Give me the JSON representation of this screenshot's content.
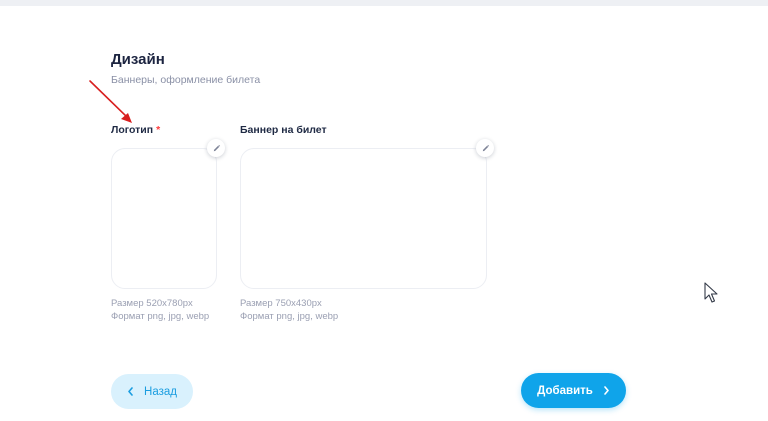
{
  "section": {
    "title": "Дизайн",
    "subtitle": "Баннеры, оформление билета"
  },
  "logo": {
    "label": "Логотип",
    "required_mark": "*",
    "size_hint": "Размер 520х780px",
    "format_hint": "Формат png, jpg, webp"
  },
  "banner": {
    "label": "Баннер на билет",
    "size_hint": "Размер 750х430px",
    "format_hint": "Формат png, jpg, webp"
  },
  "actions": {
    "back_label": "Назад",
    "add_label": "Добавить"
  },
  "colors": {
    "accent": "#0fa4ea",
    "required": "#ff3b3b",
    "annotation_arrow": "#d81f1f"
  },
  "icons": {
    "edit": "pencil-icon",
    "back": "chevron-left-icon",
    "forward": "chevron-right-icon"
  }
}
